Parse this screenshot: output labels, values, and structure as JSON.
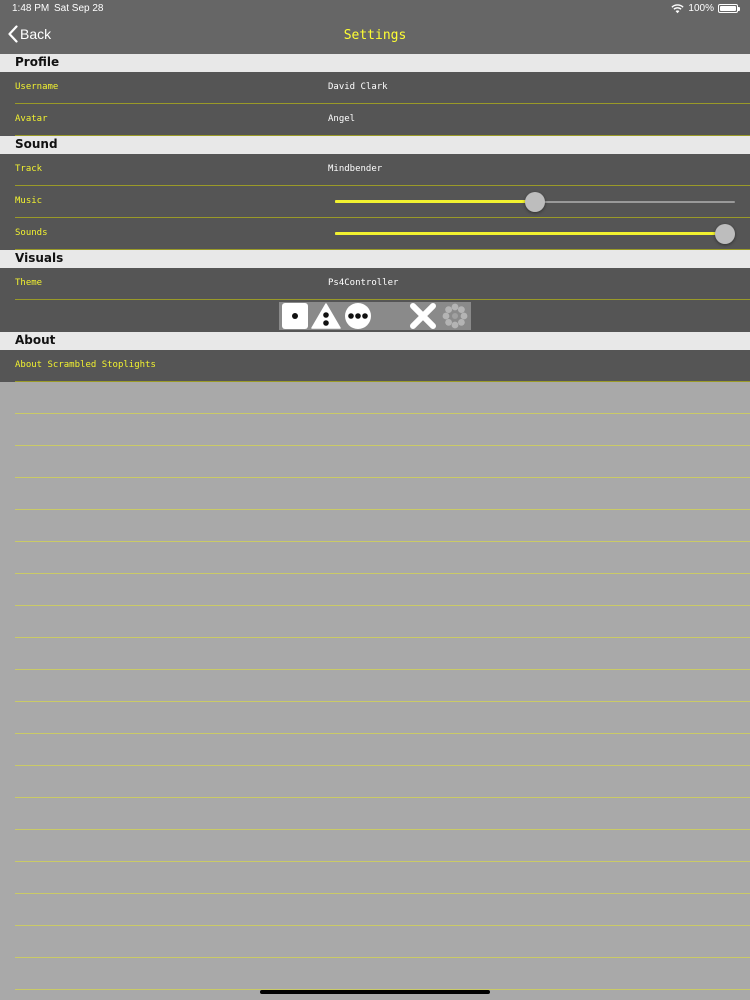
{
  "status_bar": {
    "time": "1:48 PM",
    "date": "Sat Sep 28",
    "battery": "100%"
  },
  "nav": {
    "back_label": "Back",
    "title": "Settings"
  },
  "sections": {
    "profile": {
      "title": "Profile",
      "username_label": "Username",
      "username_value": "David Clark",
      "avatar_label": "Avatar",
      "avatar_value": "Angel"
    },
    "sound": {
      "title": "Sound",
      "track_label": "Track",
      "track_value": "Mindbender",
      "music_label": "Music",
      "music_level": 0.5,
      "sounds_label": "Sounds",
      "sounds_level": 0.975
    },
    "visuals": {
      "title": "Visuals",
      "theme_label": "Theme",
      "theme_value": "Ps4Controller",
      "theme_preview_icons": [
        "square-one-dot-icon",
        "triangle-two-dots-icon",
        "circle-three-dots-icon",
        "cross-icon",
        "flower-icon"
      ]
    },
    "about": {
      "title": "About",
      "about_label": "About Scrambled Stoplights"
    }
  },
  "colors": {
    "accent": "#f2f230",
    "nav_background": "#666666",
    "row_background": "#555555",
    "section_header_background": "#e8e8e8",
    "page_background": "#a9a9a9",
    "separator": "#9a9a28"
  }
}
